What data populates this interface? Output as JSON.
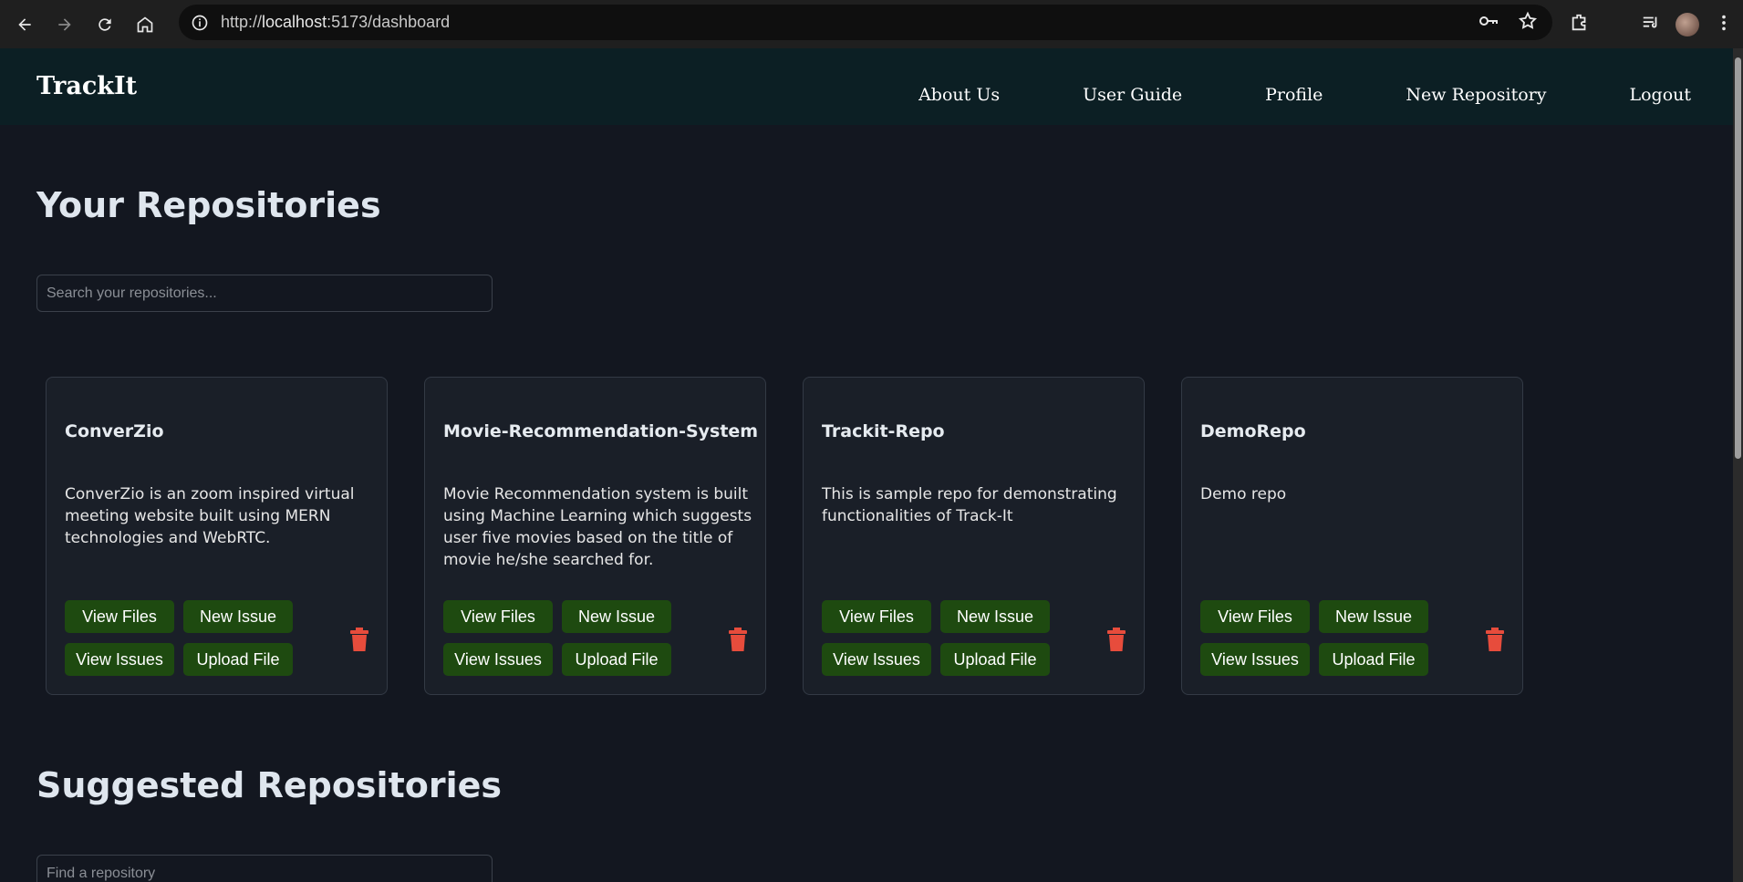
{
  "browser": {
    "url_scheme": "http://",
    "url_host": "localhost",
    "url_path": ":5173/dashboard"
  },
  "app": {
    "brand": "TrackIt",
    "nav": [
      "About Us",
      "User Guide",
      "Profile",
      "New Repository",
      "Logout"
    ]
  },
  "repositories": {
    "title": "Your Repositories",
    "search_placeholder": "Search your repositories...",
    "items": [
      {
        "name": "ConverZio",
        "description": "ConverZio is an zoom inspired virtual meeting website built using MERN technologies and WebRTC."
      },
      {
        "name": "Movie-Recommendation-System",
        "description": "Movie Recommendation system is built using Machine Learning which suggests user five movies based on the title of movie he/she searched for."
      },
      {
        "name": "Trackit-Repo",
        "description": "This is sample repo for demonstrating functionalities of Track-It"
      },
      {
        "name": "DemoRepo",
        "description": "Demo repo"
      }
    ],
    "buttons": {
      "view_files": "View Files",
      "new_issue": "New Issue",
      "view_issues": "View Issues",
      "upload_file": "Upload File"
    }
  },
  "suggested": {
    "title": "Suggested Repositories",
    "search_placeholder": "Find a repository"
  },
  "colors": {
    "navbar_bg": "#0c1f24",
    "page_bg": "#131720",
    "card_bg": "#1a1f28",
    "button_bg": "#1e4a10",
    "delete_icon": "#e74c3c"
  }
}
